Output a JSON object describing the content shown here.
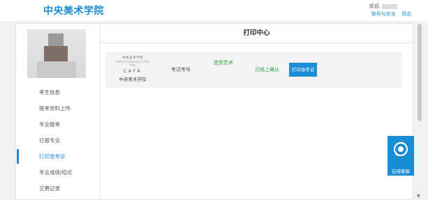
{
  "header": {
    "logo_text": "中央美术学院",
    "welcome": "欢迎,",
    "links": {
      "account_security": "账号与安全",
      "logout": "退出"
    }
  },
  "sidebar": {
    "items": [
      {
        "label": "考生信息"
      },
      {
        "label": "报考资料上传"
      },
      {
        "label": "专业报考"
      },
      {
        "label": "已报专业"
      },
      {
        "label": "打印准考证",
        "active": true
      },
      {
        "label": "专业成绩/结论"
      },
      {
        "label": "交费记录"
      }
    ]
  },
  "main": {
    "title": "打印中心",
    "row": {
      "logo_seal": "中央美术学院",
      "logo_sub": "Central Academy of Fine Arts",
      "logo_cafa": "CAFA",
      "school_name": "中央美术学院",
      "exam_no_label": "考试考号",
      "major": "造型艺术",
      "status": "已线上确认",
      "print_button": "打印准考证"
    }
  },
  "float": {
    "online_service": "在线客服"
  },
  "colors": {
    "accent": "#1a8dd6",
    "green": "#2ea34b"
  }
}
